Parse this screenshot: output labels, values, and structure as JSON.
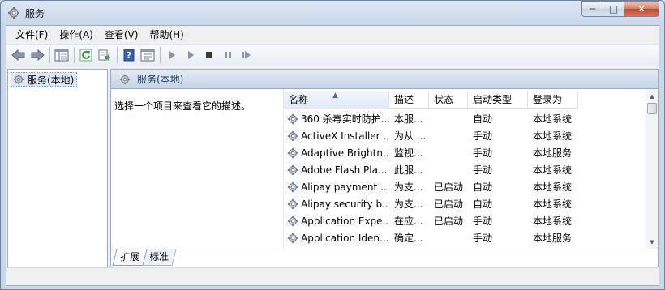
{
  "window": {
    "title": "服务"
  },
  "menu": [
    "文件(F)",
    "操作(A)",
    "查看(V)",
    "帮助(H)"
  ],
  "toolbar": {
    "icons": [
      "back-icon",
      "forward-icon",
      "show-tree-icon",
      "refresh-icon",
      "export-icon",
      "help-icon",
      "properties-icon",
      "start-icon",
      "start-alt-icon",
      "stop-icon",
      "pause-icon",
      "restart-icon"
    ]
  },
  "tree": {
    "root_label": "服务(本地)"
  },
  "pane": {
    "header": "服务(本地)",
    "description": "选择一个项目来查看它的描述。"
  },
  "table": {
    "columns": [
      "名称",
      "描述",
      "状态",
      "启动类型",
      "登录为"
    ],
    "rows": [
      [
        "360 杀毒实时防护...",
        "本服...",
        "",
        "自动",
        "本地系统"
      ],
      [
        "ActiveX Installer ...",
        "为从 ...",
        "",
        "手动",
        "本地系统"
      ],
      [
        "Adaptive Brightn...",
        "监视...",
        "",
        "手动",
        "本地服务"
      ],
      [
        "Adobe Flash Pla...",
        "此服...",
        "",
        "手动",
        "本地系统"
      ],
      [
        "Alipay payment ...",
        "为支...",
        "已启动",
        "自动",
        "本地系统"
      ],
      [
        "Alipay security b...",
        "为支...",
        "已启动",
        "自动",
        "本地系统"
      ],
      [
        "Application Expe...",
        "在应...",
        "已启动",
        "手动",
        "本地系统"
      ],
      [
        "Application Iden...",
        "确定...",
        "",
        "手动",
        "本地服务"
      ]
    ]
  },
  "tabs": [
    "扩展",
    "标准"
  ],
  "colors": {
    "accent": "#c9d7ea",
    "header": "#c4d3e7",
    "close": "#c4472c"
  }
}
